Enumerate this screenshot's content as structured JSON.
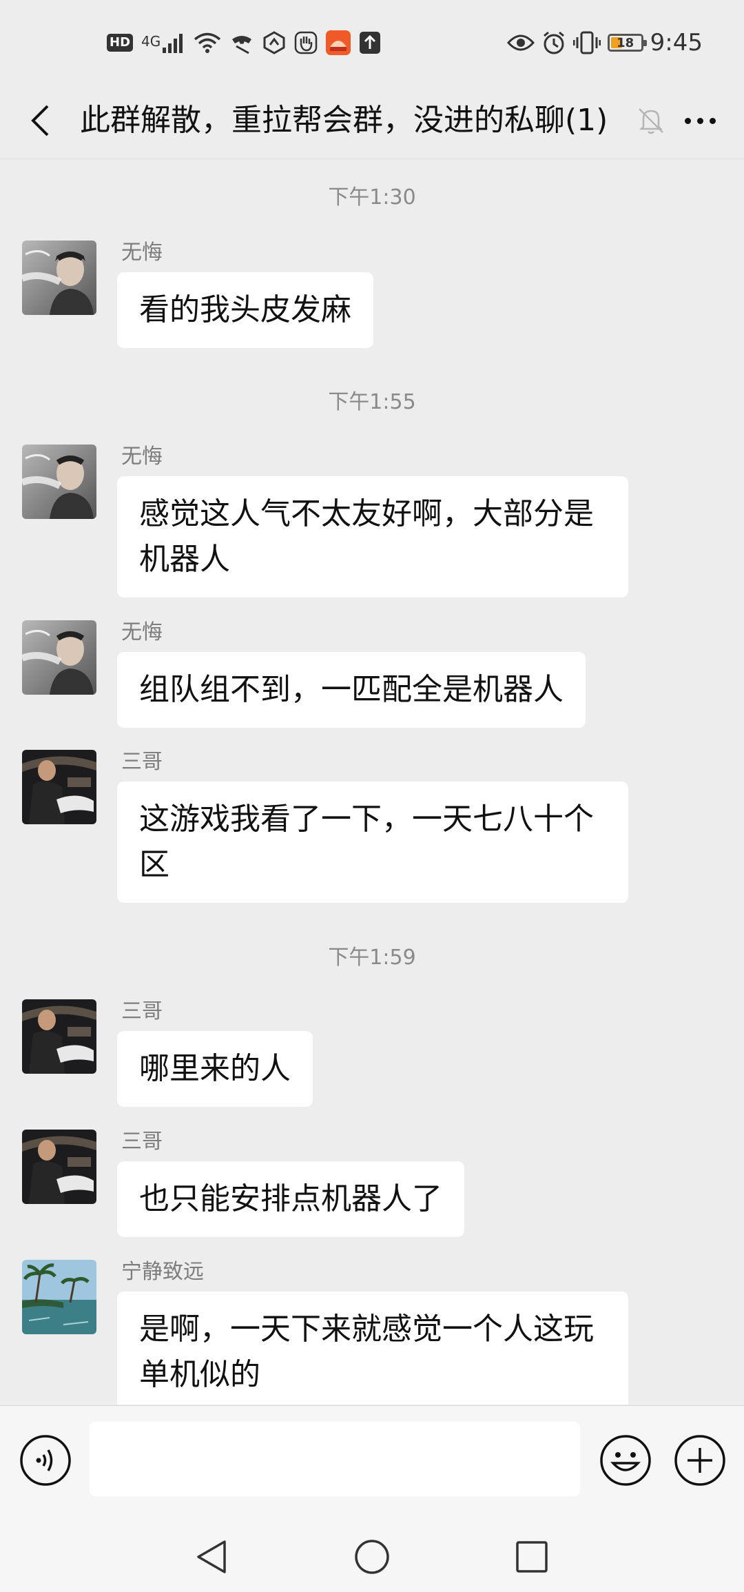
{
  "status_bar": {
    "hd_label": "HD",
    "network": "4G",
    "battery_level": "18",
    "time": "9:45"
  },
  "header": {
    "title": "此群解散，重拉帮会群，没进的私聊(1)",
    "back_icon": "chevron-left-icon",
    "mute_icon": "bell-off-icon",
    "more_icon": "more-dots-icon"
  },
  "timeline": [
    {
      "kind": "time",
      "text": "下午1:30"
    },
    {
      "kind": "message",
      "sender": "无悔",
      "avatar": "avatar-smoke",
      "text": "看的我头皮发麻"
    },
    {
      "kind": "time",
      "text": "下午1:55"
    },
    {
      "kind": "message",
      "sender": "无悔",
      "avatar": "avatar-smoke",
      "text": "感觉这人气不太友好啊，大部分是机器人"
    },
    {
      "kind": "message",
      "sender": "无悔",
      "avatar": "avatar-smoke",
      "text": "组队组不到，一匹配全是机器人"
    },
    {
      "kind": "message",
      "sender": "三哥",
      "avatar": "avatar-car",
      "text": "这游戏我看了一下，一天七八十个区"
    },
    {
      "kind": "time",
      "text": "下午1:59"
    },
    {
      "kind": "message",
      "sender": "三哥",
      "avatar": "avatar-car",
      "text": "哪里来的人"
    },
    {
      "kind": "message",
      "sender": "三哥",
      "avatar": "avatar-car",
      "text": "也只能安排点机器人了"
    },
    {
      "kind": "message",
      "sender": "宁静致远",
      "avatar": "avatar-beach",
      "text": "是啊，一天下来就感觉一个人这玩单机似的"
    }
  ],
  "input_bar": {
    "voice_icon": "voice-icon",
    "input_value": "",
    "emoji_icon": "emoji-icon",
    "plus_icon": "plus-icon"
  },
  "nav_bar": {
    "back_icon": "nav-back-icon",
    "home_icon": "nav-home-icon",
    "recent_icon": "nav-recent-icon"
  }
}
